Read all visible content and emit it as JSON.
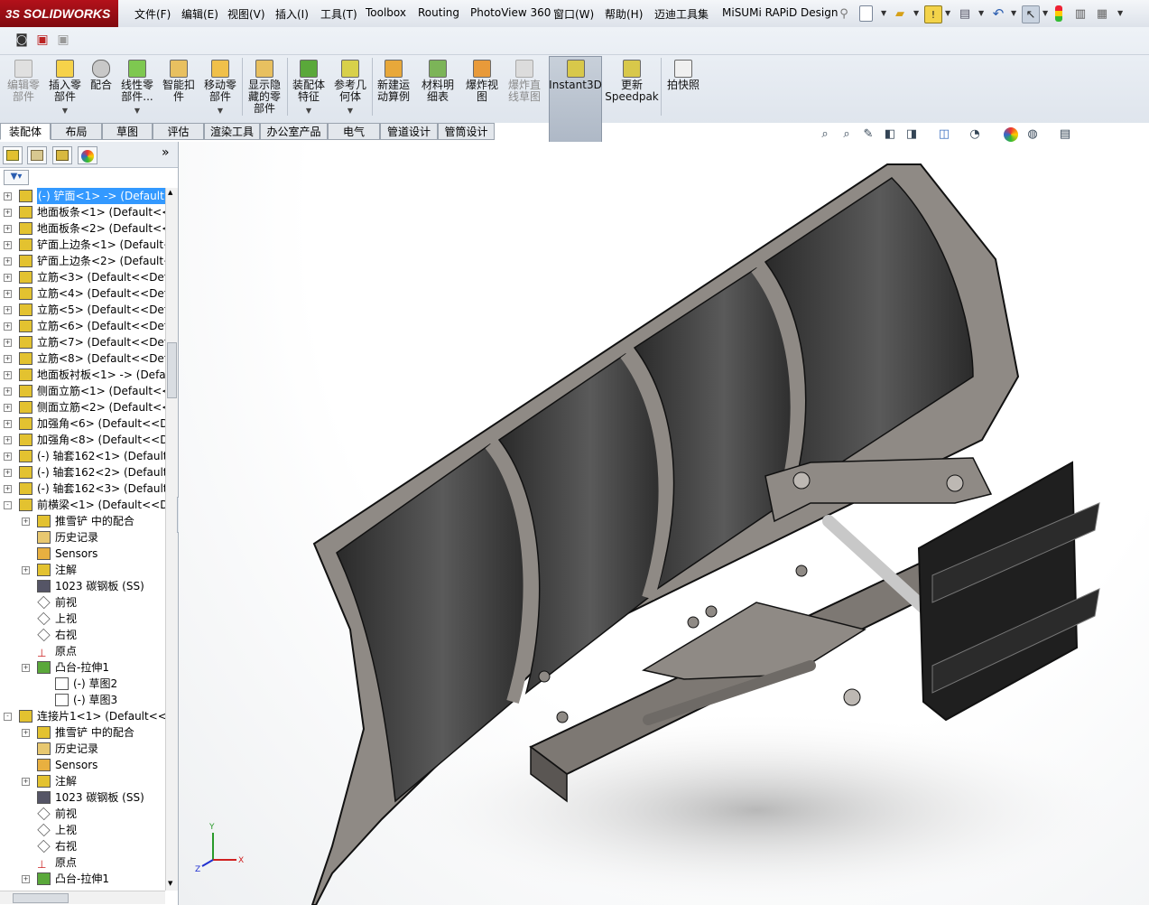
{
  "app": {
    "logo_prefix": "3S",
    "logo_text": "SOLIDWORKS"
  },
  "menu": {
    "items": [
      "文件(F)",
      "编辑(E)",
      "视图(V)",
      "插入(I)",
      "工具(T)",
      "Toolbox",
      "Routing",
      "PhotoView 360",
      "窗口(W)",
      "帮助(H)",
      "迈迪工具集",
      "MiSUMi RAPiD Design"
    ]
  },
  "command_manager": {
    "buttons": [
      {
        "label": "编辑零\n部件",
        "icon": "edit-component-icon",
        "enabled": false
      },
      {
        "label": "插入零\n部件",
        "icon": "insert-component-icon",
        "enabled": true
      },
      {
        "label": "配合",
        "icon": "mate-icon",
        "enabled": true
      },
      {
        "label": "线性零\n部件...",
        "icon": "linear-pattern-icon",
        "enabled": true
      },
      {
        "label": "智能扣\n件",
        "icon": "smart-fasteners-icon",
        "enabled": true
      },
      {
        "label": "移动零\n部件",
        "icon": "move-component-icon",
        "enabled": true
      },
      {
        "label": "显示隐\n藏的零\n部件",
        "icon": "show-hidden-icon",
        "enabled": true
      },
      {
        "label": "装配体\n特征",
        "icon": "assembly-feature-icon",
        "enabled": true
      },
      {
        "label": "参考几\n何体",
        "icon": "reference-geometry-icon",
        "enabled": true
      },
      {
        "label": "新建运\n动算例",
        "icon": "new-motion-study-icon",
        "enabled": true
      },
      {
        "label": "材料明\n细表",
        "icon": "bom-icon",
        "enabled": true
      },
      {
        "label": "爆炸视\n图",
        "icon": "exploded-view-icon",
        "enabled": true
      },
      {
        "label": "爆炸直\n线草图",
        "icon": "explode-line-sketch-icon",
        "enabled": false
      },
      {
        "label": "Instant3D",
        "icon": "instant3d-icon",
        "enabled": true
      },
      {
        "label": "更新\nSpeedpak",
        "icon": "speedpak-icon",
        "enabled": true
      },
      {
        "label": "拍快照",
        "icon": "snapshot-icon",
        "enabled": true
      }
    ]
  },
  "tabs": [
    "装配体",
    "布局",
    "草图",
    "评估",
    "渲染工具",
    "办公室产品",
    "电气",
    "管道设计",
    "管筒设计"
  ],
  "active_tab": "装配体",
  "panel": {
    "expand_glyph": "»"
  },
  "tree": [
    {
      "label": "(-) 铲面<1> -> (Default<",
      "depth": 0,
      "toggle": "+",
      "icon": "part",
      "selected": true
    },
    {
      "label": "地面板条<1> (Default<<",
      "depth": 0,
      "toggle": "+",
      "icon": "part"
    },
    {
      "label": "地面板条<2> (Default<<",
      "depth": 0,
      "toggle": "+",
      "icon": "part"
    },
    {
      "label": "铲面上边条<1> (Default<",
      "depth": 0,
      "toggle": "+",
      "icon": "part"
    },
    {
      "label": "铲面上边条<2> (Default<",
      "depth": 0,
      "toggle": "+",
      "icon": "part"
    },
    {
      "label": "立筋<3> (Default<<Defa",
      "depth": 0,
      "toggle": "+",
      "icon": "part"
    },
    {
      "label": "立筋<4> (Default<<Defa",
      "depth": 0,
      "toggle": "+",
      "icon": "part"
    },
    {
      "label": "立筋<5> (Default<<Defa",
      "depth": 0,
      "toggle": "+",
      "icon": "part"
    },
    {
      "label": "立筋<6> (Default<<Defa",
      "depth": 0,
      "toggle": "+",
      "icon": "part"
    },
    {
      "label": "立筋<7> (Default<<Defa",
      "depth": 0,
      "toggle": "+",
      "icon": "part"
    },
    {
      "label": "立筋<8> (Default<<Defa",
      "depth": 0,
      "toggle": "+",
      "icon": "part"
    },
    {
      "label": "地面板衬板<1> -> (Defa",
      "depth": 0,
      "toggle": "+",
      "icon": "part"
    },
    {
      "label": "侧面立筋<1> (Default<<",
      "depth": 0,
      "toggle": "+",
      "icon": "part"
    },
    {
      "label": "侧面立筋<2> (Default<<",
      "depth": 0,
      "toggle": "+",
      "icon": "part"
    },
    {
      "label": "加强角<6> (Default<<De",
      "depth": 0,
      "toggle": "+",
      "icon": "part"
    },
    {
      "label": "加强角<8> (Default<<De",
      "depth": 0,
      "toggle": "+",
      "icon": "part"
    },
    {
      "label": "(-) 轴套162<1> (Default",
      "depth": 0,
      "toggle": "+",
      "icon": "part"
    },
    {
      "label": "(-) 轴套162<2> (Default",
      "depth": 0,
      "toggle": "+",
      "icon": "part"
    },
    {
      "label": "(-) 轴套162<3> (Default",
      "depth": 0,
      "toggle": "+",
      "icon": "part"
    },
    {
      "label": "前横梁<1> (Default<<De",
      "depth": 0,
      "toggle": "-",
      "icon": "part"
    },
    {
      "label": "推雪铲 中的配合",
      "depth": 1,
      "toggle": "+",
      "icon": "mates"
    },
    {
      "label": "历史记录",
      "depth": 1,
      "toggle": "",
      "icon": "history"
    },
    {
      "label": "Sensors",
      "depth": 1,
      "toggle": "",
      "icon": "sensors"
    },
    {
      "label": "注解",
      "depth": 1,
      "toggle": "+",
      "icon": "annotation"
    },
    {
      "label": "1023 碳钢板 (SS)",
      "depth": 1,
      "toggle": "",
      "icon": "material"
    },
    {
      "label": "前视",
      "depth": 1,
      "toggle": "",
      "icon": "plane"
    },
    {
      "label": "上视",
      "depth": 1,
      "toggle": "",
      "icon": "plane"
    },
    {
      "label": "右视",
      "depth": 1,
      "toggle": "",
      "icon": "plane"
    },
    {
      "label": "原点",
      "depth": 1,
      "toggle": "",
      "icon": "origin"
    },
    {
      "label": "凸台-拉伸1",
      "depth": 1,
      "toggle": "+",
      "icon": "extrude"
    },
    {
      "label": "(-) 草图2",
      "depth": 2,
      "toggle": "",
      "icon": "sketch"
    },
    {
      "label": "(-) 草图3",
      "depth": 2,
      "toggle": "",
      "icon": "sketch"
    },
    {
      "label": "连接片1<1> (Default<<D",
      "depth": 0,
      "toggle": "-",
      "icon": "part"
    },
    {
      "label": "推雪铲 中的配合",
      "depth": 1,
      "toggle": "+",
      "icon": "mates"
    },
    {
      "label": "历史记录",
      "depth": 1,
      "toggle": "",
      "icon": "history"
    },
    {
      "label": "Sensors",
      "depth": 1,
      "toggle": "",
      "icon": "sensors"
    },
    {
      "label": "注解",
      "depth": 1,
      "toggle": "+",
      "icon": "annotation"
    },
    {
      "label": "1023 碳钢板 (SS)",
      "depth": 1,
      "toggle": "",
      "icon": "material"
    },
    {
      "label": "前视",
      "depth": 1,
      "toggle": "",
      "icon": "plane"
    },
    {
      "label": "上视",
      "depth": 1,
      "toggle": "",
      "icon": "plane"
    },
    {
      "label": "右视",
      "depth": 1,
      "toggle": "",
      "icon": "plane"
    },
    {
      "label": "原点",
      "depth": 1,
      "toggle": "",
      "icon": "origin"
    },
    {
      "label": "凸台-拉伸1",
      "depth": 1,
      "toggle": "+",
      "icon": "extrude"
    }
  ],
  "triad": {
    "x_label": "X",
    "y_label": "Y",
    "z_label": "Z"
  },
  "colors": {
    "logo_red": "#a3101a",
    "selection_blue": "#3399ff",
    "model_steel": "#8f8a85",
    "model_dark": "#2b2b2b"
  }
}
